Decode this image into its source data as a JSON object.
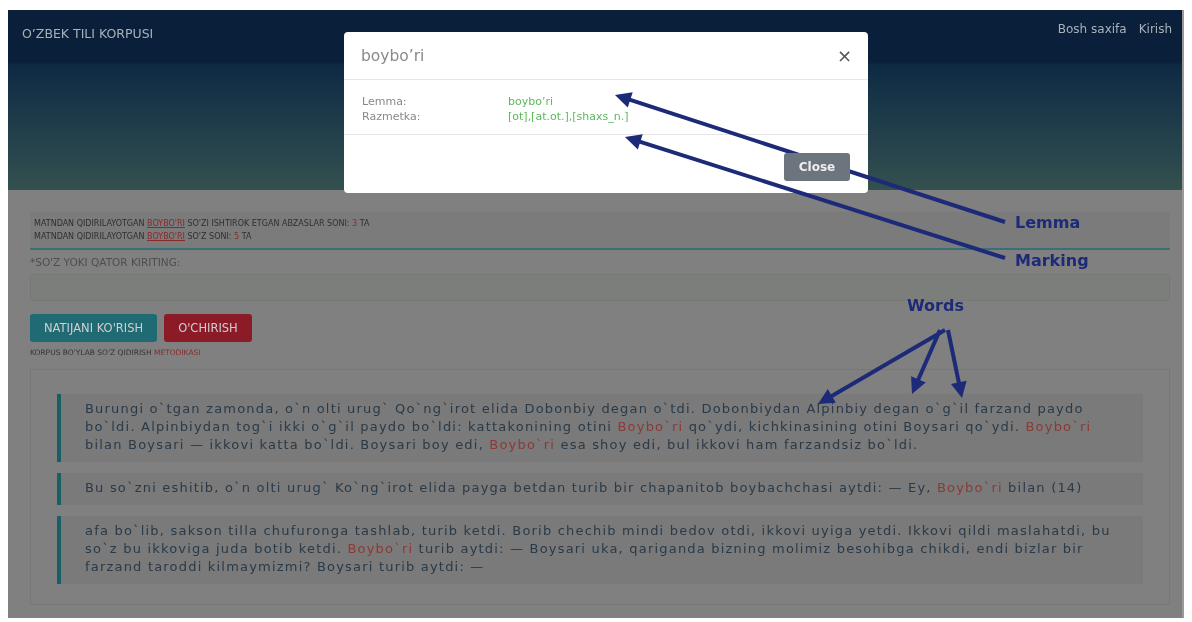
{
  "header": {
    "brand": "O’ZBEK TILI KORPUSI",
    "nav": [
      "Bosh saxifa",
      "Kirish"
    ]
  },
  "stats": [
    {
      "segments": [
        {
          "kind": "plain",
          "text": "MATNDAN QIDIRILAYOTGAN "
        },
        {
          "kind": "link",
          "text": "BOYBO'RI"
        },
        {
          "kind": "plain",
          "text": " SO'ZI ISHTIROK ETGAN ABZASLAR SONI: "
        },
        {
          "kind": "count",
          "text": "3"
        },
        {
          "kind": "plain",
          "text": " TA"
        }
      ]
    },
    {
      "segments": [
        {
          "kind": "plain",
          "text": "MATNDAN QIDIRILAYOTGAN "
        },
        {
          "kind": "link",
          "text": "BOYBO'RI"
        },
        {
          "kind": "plain",
          "text": " SO'Z SONI: "
        },
        {
          "kind": "count",
          "text": "5"
        },
        {
          "kind": "plain",
          "text": " TA"
        }
      ]
    }
  ],
  "search": {
    "label": "*SO'Z YOKI QATOR KIRITING:"
  },
  "buttons": [
    {
      "label": "NATIJANI KO'RISH",
      "kind": "primary"
    },
    {
      "label": "O'CHIRISH",
      "kind": "danger"
    }
  ],
  "method": {
    "text": "KORPUS BO'YLAB SO'Z QIDIRISH",
    "link": "METODIKASI"
  },
  "paragraphs": [
    {
      "segments": [
        {
          "kind": "plain",
          "text": "Burungi o`tgan zamonda, o`n olti urug` Qo`ng`irot elida Dobonbiy degan o`tdi. Dobonbiydan Alpinbiy degan o`g`il farzand paydo bo`ldi. Alpinbiydan tog`i ikki o`g`il paydo bo`ldi: kattakonining otini "
        },
        {
          "kind": "hit",
          "text": "Boybo`ri"
        },
        {
          "kind": "plain",
          "text": " qo`ydi, kichkinasining otini Boysari qo`ydi. "
        },
        {
          "kind": "hit",
          "text": "Boybo`ri"
        },
        {
          "kind": "plain",
          "text": " bilan Boysari — ikkovi katta bo`ldi. Boysari boy edi, "
        },
        {
          "kind": "hit",
          "text": "Boybo`ri"
        },
        {
          "kind": "plain",
          "text": " esa shoy edi, bul ikkovi ham farzandsiz bo`ldi."
        }
      ]
    },
    {
      "segments": [
        {
          "kind": "plain",
          "text": "Bu so`zni eshitib, o`n olti urug` Ko`ng`irot elida payga betdan turib bir chapanitob boybachchasi aytdi: — Ey, "
        },
        {
          "kind": "hit",
          "text": "Boybo`ri"
        },
        {
          "kind": "plain",
          "text": " bilan (14)"
        }
      ]
    },
    {
      "segments": [
        {
          "kind": "plain",
          "text": "afa bo`lib, sakson tilla chufuronga tashlab, turib ketdi. Borib chechib mindi bedov otdi, ikkovi uyiga yetdi. Ikkovi qildi maslahatdi, bu so`z bu ikkoviga juda botib ketdi. "
        },
        {
          "kind": "hit",
          "text": "Boybo`ri"
        },
        {
          "kind": "plain",
          "text": " turib aytdi: — Boysari uka, qariganda bizning molimiz besohibga chikdi, endi bizlar bir farzand taroddi kilmaymizmi? Boysari turib aytdi: —"
        }
      ]
    }
  ],
  "modal": {
    "title": "boybo’ri",
    "close_icon": "×",
    "fields": [
      {
        "label": "Lemma:",
        "value": "boybo’ri"
      },
      {
        "label": "Razmetka:",
        "value": "[ot],[at.ot.],[shaxs_n.]"
      }
    ],
    "button": "Close"
  },
  "annotations": [
    {
      "label": "Lemma"
    },
    {
      "label": "Marking"
    },
    {
      "label": "Words"
    }
  ]
}
